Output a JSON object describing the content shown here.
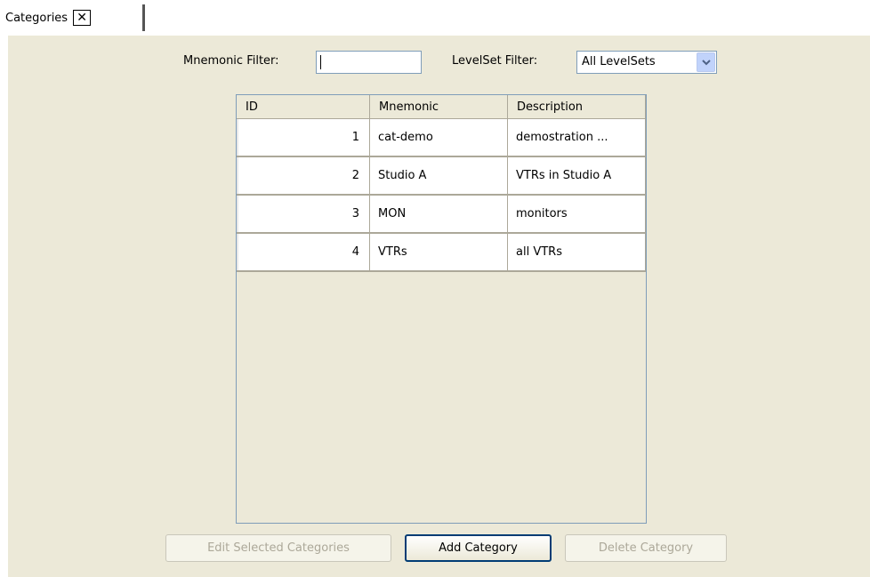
{
  "tab": {
    "label": "Categories",
    "close_glyph": "✕"
  },
  "filters": {
    "mnemonic_label": "Mnemonic Filter:",
    "mnemonic_value": "",
    "levelset_label": "LevelSet Filter:",
    "levelset_value": "All LevelSets"
  },
  "table": {
    "columns": [
      "ID",
      "Mnemonic",
      "Description"
    ],
    "rows": [
      {
        "id": "1",
        "mnemonic": "cat-demo",
        "description": "demostration ..."
      },
      {
        "id": "2",
        "mnemonic": "Studio A",
        "description": "VTRs in Studio A"
      },
      {
        "id": "3",
        "mnemonic": "MON",
        "description": "monitors"
      },
      {
        "id": "4",
        "mnemonic": "VTRs",
        "description": "all VTRs"
      }
    ]
  },
  "buttons": {
    "edit": "Edit Selected Categories",
    "add": "Add Category",
    "delete": "Delete Category"
  }
}
